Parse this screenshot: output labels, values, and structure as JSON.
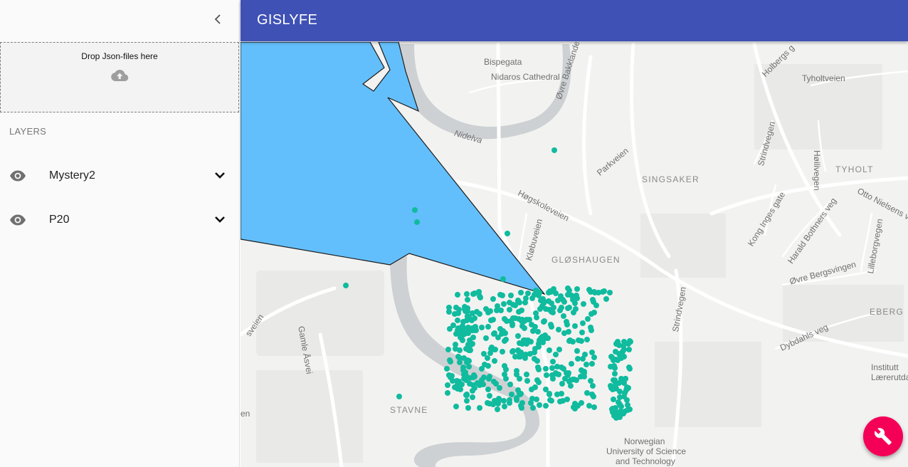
{
  "app": {
    "title": "GISLYFE"
  },
  "sidebar": {
    "collapse_icon": "chevron-left-icon",
    "dropzone": {
      "label": "Drop Json-files here",
      "icon": "cloud-upload-icon"
    },
    "layers_heading": "LAYERS",
    "layers": [
      {
        "name": "Mystery2",
        "visible": true,
        "expand_icon": "chevron-down-icon"
      },
      {
        "name": "P20",
        "visible": true,
        "expand_icon": "chevron-down-icon"
      }
    ]
  },
  "map": {
    "polygon_fill": "#63bffb",
    "point_color": "#10bb9e",
    "labels": {
      "bispegata": "Bispegata",
      "cathedral": "Nidaros Cathedral",
      "nidelva": "Nidelva",
      "ovre_bakklandet": "Øvre Bakklandet",
      "parkveien": "Parkveien",
      "singsaker": "SINGSAKER",
      "hogskoleveien": "Høgskoleveien",
      "kuebuveien": "Kløbuveien",
      "gloshaugen": "GLØSHAUGEN",
      "strindvegen": "Strindvegen",
      "strindvegen2": "Strindvegen",
      "holbergs": "Holbergs g",
      "tyholtveien": "Tyholtveien",
      "hollivegen": "Høilivegen",
      "tyholt": "TYHOLT",
      "otto_nielsens": "Otto Nielsens ve",
      "kong_inges": "Kong Inges gate",
      "harald_bothners": "Harald Bothners veg",
      "lilleborgvegen": "Lilleborgvegen",
      "ovre_bergsvingen": "Øvre Bergsvingen",
      "eberg": "EBERG",
      "dybdahls": "Dybdahls veg",
      "institutt": "Institutt",
      "laerurtda": "Lærerutda",
      "gamle_asvei": "Gamle Åsvei",
      "sveien": "sveien",
      "stavne": "STAVNE",
      "en": "en",
      "ntnu1": "Norwegian",
      "ntnu2": "University of Science",
      "ntnu3": "and Technology"
    }
  },
  "fab": {
    "icon": "wrench-icon"
  }
}
